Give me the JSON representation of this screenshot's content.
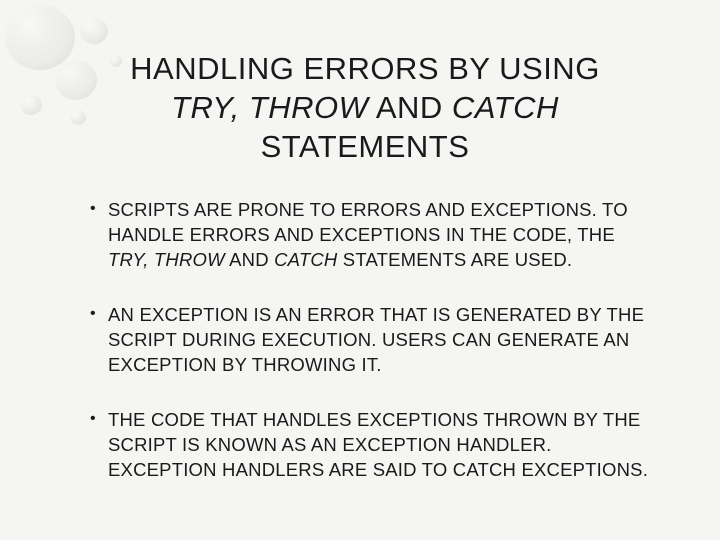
{
  "title": {
    "line1_pre": "HANDLING ERRORS BY USING",
    "line2_try_throw": "TRY, THROW",
    "line2_and": " AND ",
    "line2_catch": "CATCH",
    "line3": "STATEMENTS"
  },
  "bullets": [
    {
      "seg1": "SCRIPTS ARE PRONE TO ERRORS AND EXCEPTIONS. TO HANDLE ERRORS AND EXCEPTIONS IN THE CODE, THE ",
      "kw1": "TRY, THROW",
      "seg2": " AND ",
      "kw2": "CATCH",
      "seg3": " STATEMENTS ARE USED."
    },
    {
      "seg1": "AN EXCEPTION IS AN ERROR THAT IS GENERATED BY THE SCRIPT DURING EXECUTION. USERS CAN GENERATE AN EXCEPTION BY THROWING IT."
    },
    {
      "seg1": "THE CODE THAT HANDLES EXCEPTIONS THROWN BY THE SCRIPT IS KNOWN AS AN EXCEPTION HANDLER. EXCEPTION HANDLERS ARE SAID TO CATCH EXCEPTIONS."
    }
  ]
}
